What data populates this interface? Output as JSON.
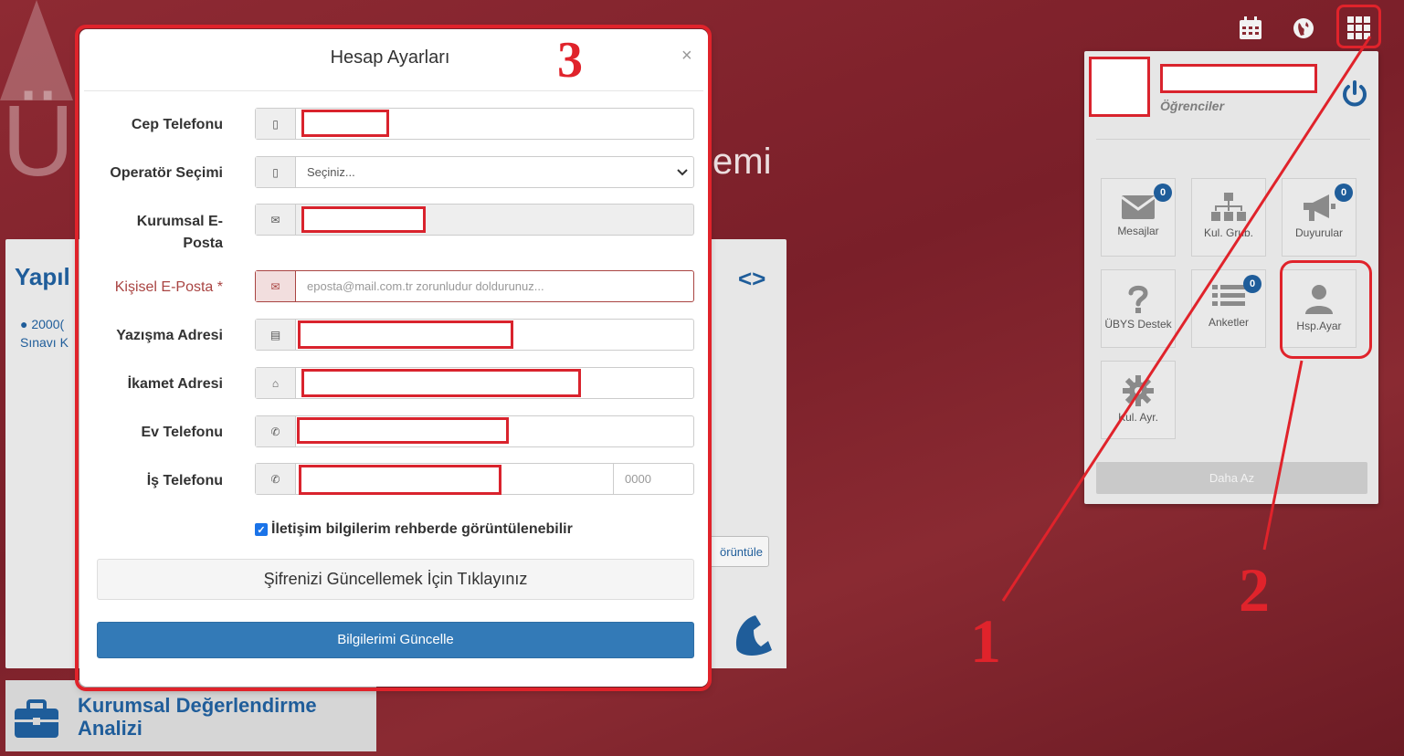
{
  "background": {
    "logo_text": "Ü",
    "title_fragment": "emi",
    "panel_title": "Yapıl",
    "panel_code_icon": "code-brackets-icon",
    "panel_item_line1": "● 2000(",
    "panel_item_line2": "Sınavı K",
    "view_button": "örüntüle",
    "bottom_card_title_line1": "Kurumsal Değerlendirme",
    "bottom_card_title_line2": "Analizi"
  },
  "top_bar": {
    "icons": [
      "calendar-icon",
      "globe-icon",
      "apps-grid-icon"
    ]
  },
  "user_panel": {
    "role": "Öğrenciler",
    "tiles": [
      {
        "label": "Mesajlar",
        "icon": "envelope-icon",
        "badge": "0"
      },
      {
        "label": "Kul. Grub.",
        "icon": "org-chart-icon",
        "badge": ""
      },
      {
        "label": "Duyurular",
        "icon": "megaphone-icon",
        "badge": "0"
      },
      {
        "label": "ÜBYS Destek",
        "icon": "question-icon",
        "badge": ""
      },
      {
        "label": "Anketler",
        "icon": "list-icon",
        "badge": "0"
      },
      {
        "label": "Hsp.Ayar",
        "icon": "user-icon",
        "badge": ""
      },
      {
        "label": "Kul. Ayr.",
        "icon": "gear-icon",
        "badge": ""
      }
    ],
    "less_button": "Daha Az"
  },
  "annotations": {
    "step1": "1",
    "step2": "2",
    "step3": "3"
  },
  "modal": {
    "title": "Hesap Ayarları",
    "close": "×",
    "fields": [
      {
        "label": "Cep Telefonu",
        "icon": "mobile-icon",
        "value": ""
      },
      {
        "label": "Operatör Seçimi",
        "icon": "mobile-icon",
        "value": "Seçiniz..."
      },
      {
        "label": "Kurumsal E-Posta",
        "icon": "envelope-icon",
        "value": ""
      },
      {
        "label": "Kişisel E-Posta *",
        "icon": "envelope-icon",
        "placeholder": "eposta@mail.com.tr zorunludur doldurunuz..."
      },
      {
        "label": "Yazışma Adresi",
        "icon": "building-icon",
        "value": ""
      },
      {
        "label": "İkamet Adresi",
        "icon": "home-icon",
        "value": ""
      },
      {
        "label": "Ev Telefonu",
        "icon": "phone-square-icon",
        "value": ""
      },
      {
        "label": "İş Telefonu",
        "icon": "phone-icon",
        "value": "",
        "extension_placeholder": "0000"
      }
    ],
    "label_kurumsal_line1": "Kurumsal E-",
    "label_kurumsal_line2": "Posta",
    "checkbox_label": "İletişim bilgilerim rehberde görüntülenebilir",
    "checkbox_checked": true,
    "password_button": "Şifrenizi Güncellemek İçin Tıklayınız",
    "update_button": "Bilgilerimi Güncelle"
  },
  "colors": {
    "background": "#7a1f29",
    "primary": "#337ab7",
    "annotation_red": "#e0232b",
    "error": "#a94442"
  }
}
